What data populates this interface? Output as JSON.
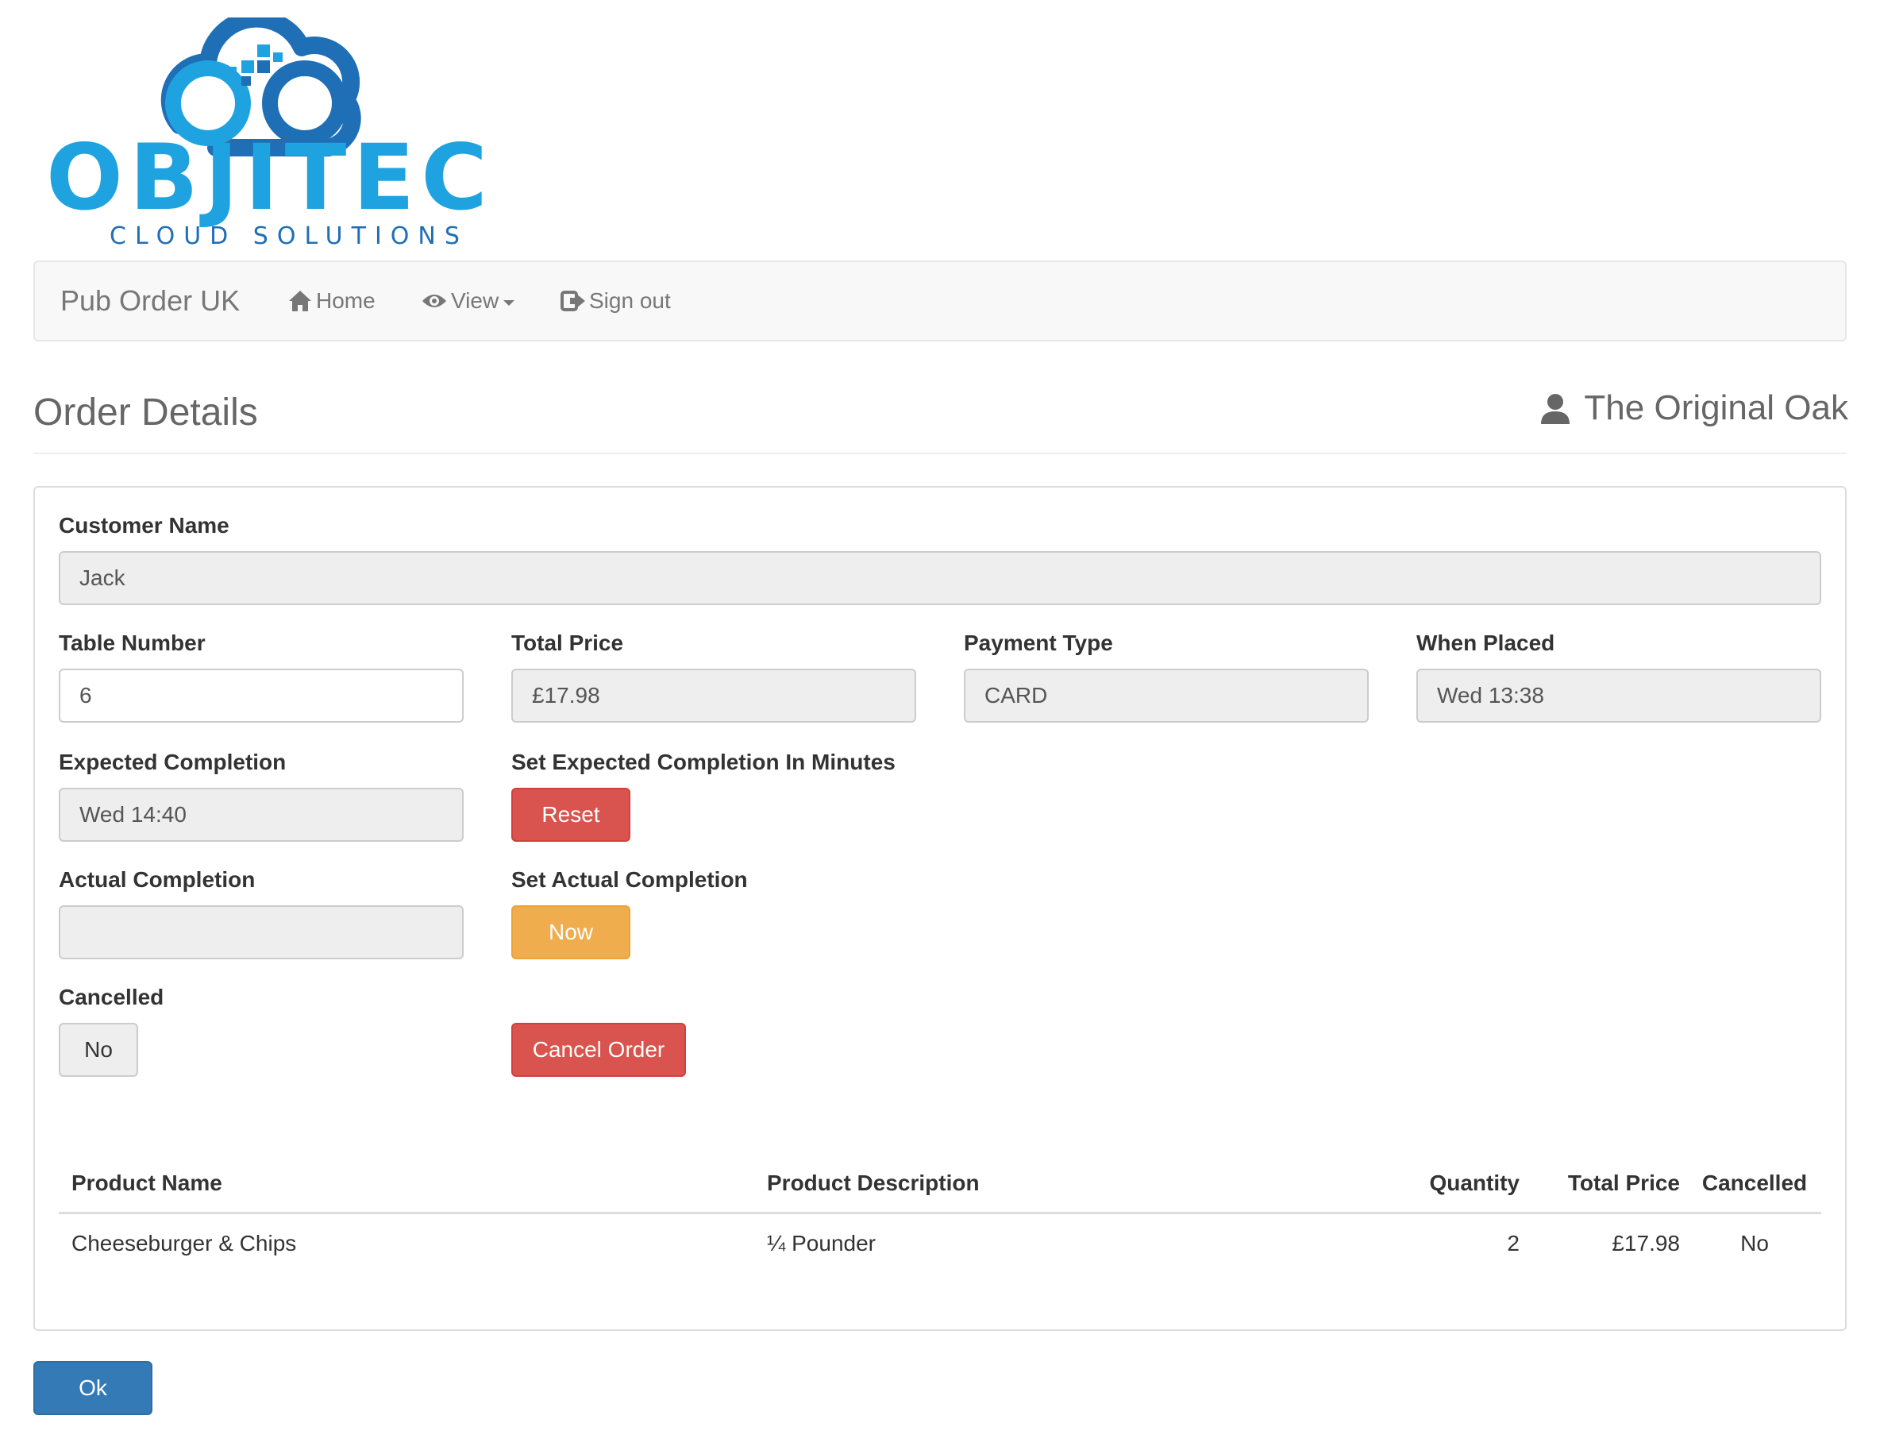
{
  "logo": {
    "name": "OBJITEC",
    "tagline": "CLOUD SOLUTIONS",
    "colors": {
      "primary": "#1fa3e0",
      "dark": "#1f6fb6"
    }
  },
  "navbar": {
    "brand": "Pub Order UK",
    "home": "Home",
    "view": "View",
    "sign_out": "Sign out"
  },
  "header": {
    "title": "Order Details",
    "venue": "The Original Oak"
  },
  "form": {
    "customer_name": {
      "label": "Customer Name",
      "value": "Jack"
    },
    "table_number": {
      "label": "Table Number",
      "value": "6"
    },
    "total_price": {
      "label": "Total Price",
      "value": "£17.98"
    },
    "payment_type": {
      "label": "Payment Type",
      "value": "CARD"
    },
    "when_placed": {
      "label": "When Placed",
      "value": "Wed 13:38"
    },
    "expected_completion": {
      "label": "Expected Completion",
      "value": "Wed 14:40"
    },
    "set_expected": {
      "label": "Set Expected Completion In Minutes",
      "button": "Reset"
    },
    "actual_completion": {
      "label": "Actual Completion",
      "value": ""
    },
    "set_actual": {
      "label": "Set Actual Completion",
      "button": "Now"
    },
    "cancelled": {
      "label": "Cancelled",
      "value": "No"
    },
    "cancel_order": {
      "button": "Cancel Order"
    }
  },
  "items_table": {
    "headers": {
      "product_name": "Product Name",
      "product_description": "Product Description",
      "quantity": "Quantity",
      "total_price": "Total Price",
      "cancelled": "Cancelled"
    },
    "rows": [
      {
        "product_name": "Cheeseburger & Chips",
        "product_description": "¼ Pounder",
        "quantity": "2",
        "total_price": "£17.98",
        "cancelled": "No"
      }
    ]
  },
  "footer": {
    "ok": "Ok"
  },
  "colors": {
    "danger": "#d9534f",
    "warning": "#f0ad4e",
    "primary": "#337ab7"
  }
}
